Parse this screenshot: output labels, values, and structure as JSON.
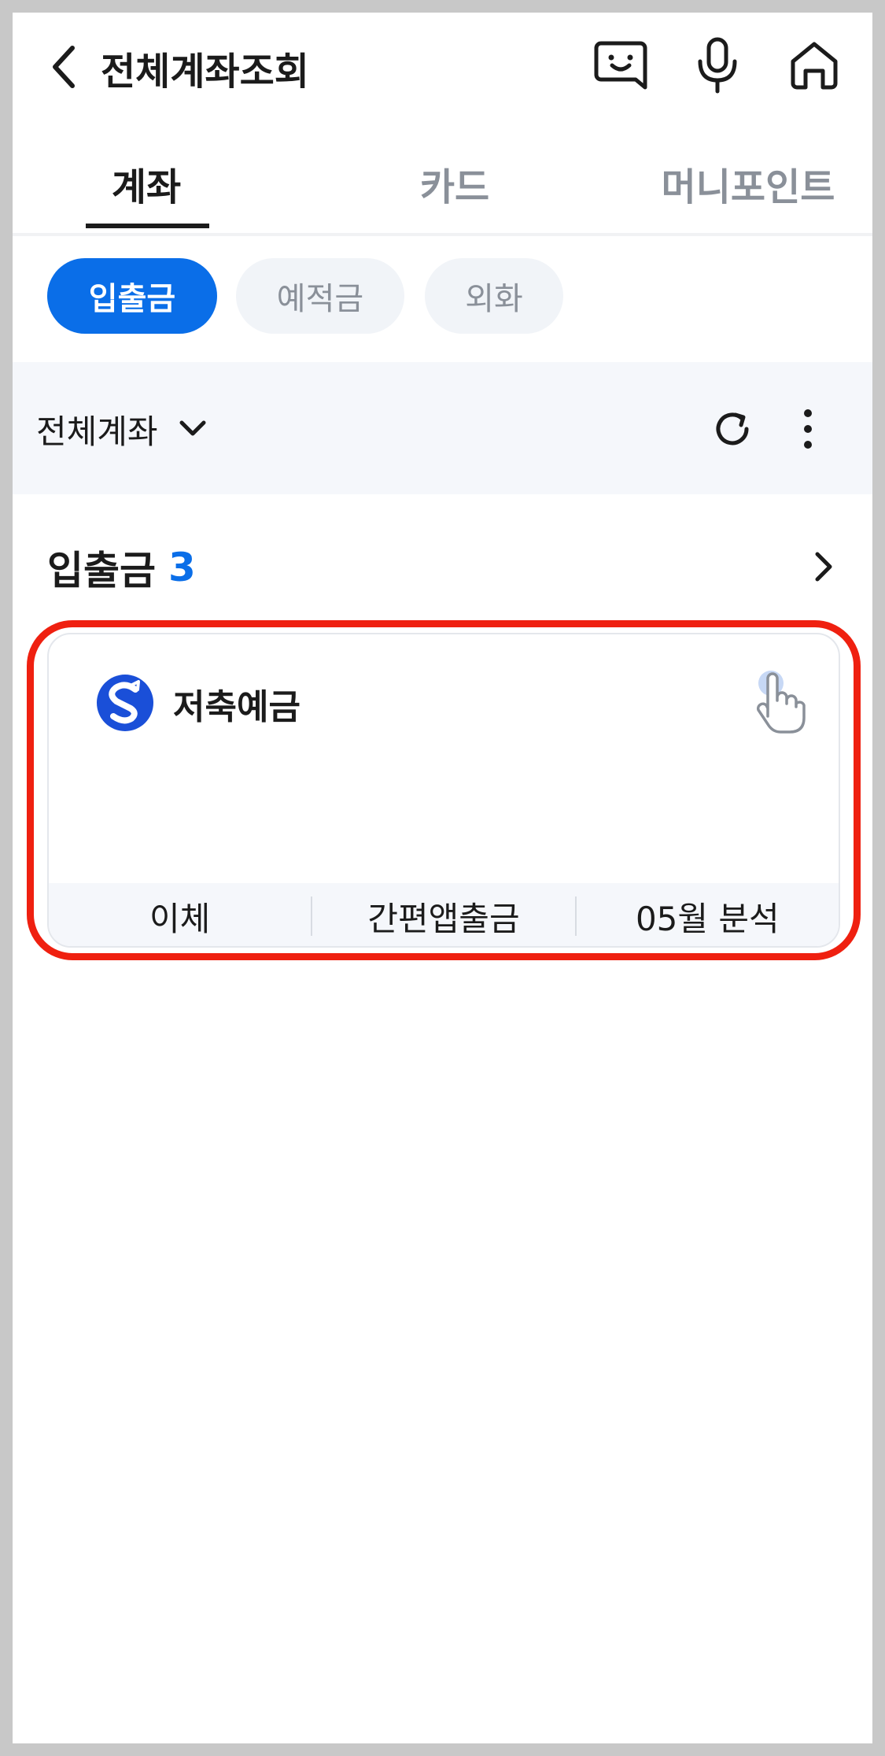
{
  "header": {
    "title": "전체계좌조회",
    "icons": [
      "back-icon",
      "chatbot-icon",
      "microphone-icon",
      "home-icon"
    ]
  },
  "main_tabs": [
    {
      "label": "계좌",
      "active": true
    },
    {
      "label": "카드",
      "active": false
    },
    {
      "label": "머니포인트",
      "active": false
    }
  ],
  "sub_tabs": [
    {
      "label": "입출금",
      "active": true
    },
    {
      "label": "예적금",
      "active": false
    },
    {
      "label": "외화",
      "active": false
    }
  ],
  "filter": {
    "selected": "전체계좌",
    "icons": [
      "chevron-down-icon",
      "refresh-icon",
      "more-vertical-icon"
    ]
  },
  "section": {
    "title": "입출금",
    "count": "3"
  },
  "account_card": {
    "name": "저축예금",
    "actions": [
      "이체",
      "간편앱출금",
      "05월 분석"
    ]
  },
  "colors": {
    "accent": "#0a6ee8",
    "highlight": "#ef2010",
    "chip_bg": "#f1f4f8",
    "filter_bg": "#f5f7fb"
  }
}
